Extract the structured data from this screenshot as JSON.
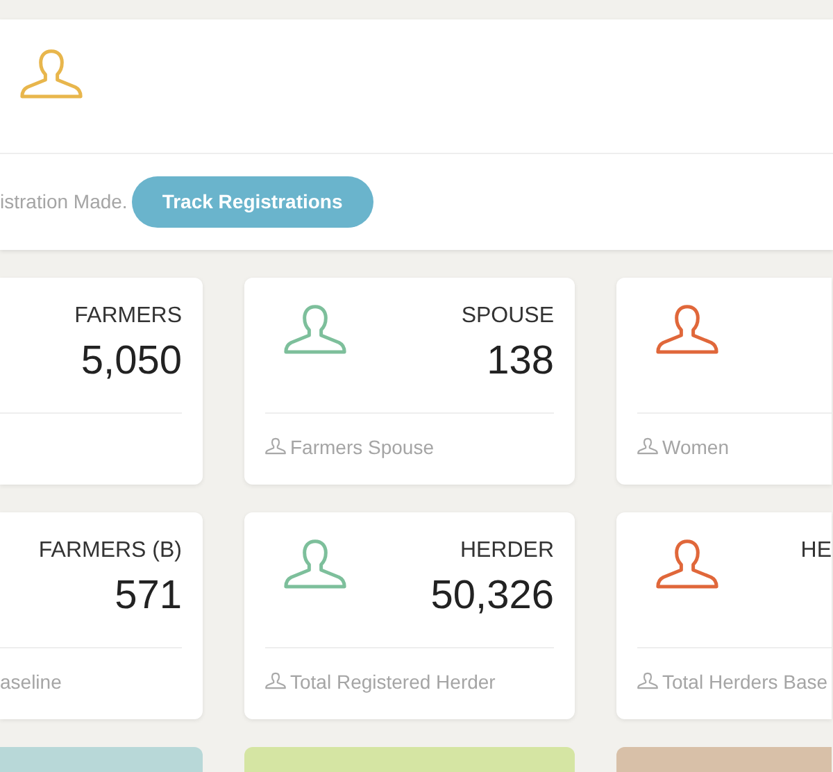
{
  "header": {
    "notice": "istration Made.",
    "button": "Track Registrations"
  },
  "stat_rows": [
    [
      {
        "title": "FARMERS",
        "value": "5,050"
      },
      {
        "color": "#7dbf9b",
        "title": "SPOUSE",
        "value": "138",
        "footer": "Farmers Spouse"
      },
      {
        "color": "#e0673a",
        "footer": "Women"
      }
    ],
    [
      {
        "title": "FARMERS (B)",
        "value": "571",
        "footer": "aseline"
      },
      {
        "color": "#7dbf9b",
        "title": "HERDER",
        "value": "50,326",
        "footer": "Total Registered Herder"
      },
      {
        "color": "#e0673a",
        "title": "HE",
        "footer": "Total Herders Base"
      }
    ]
  ],
  "summary_cards": [
    {
      "color": "#b8d8d8"
    },
    {
      "color": "#d5e5a3"
    },
    {
      "color": "#d8c0a8"
    }
  ]
}
